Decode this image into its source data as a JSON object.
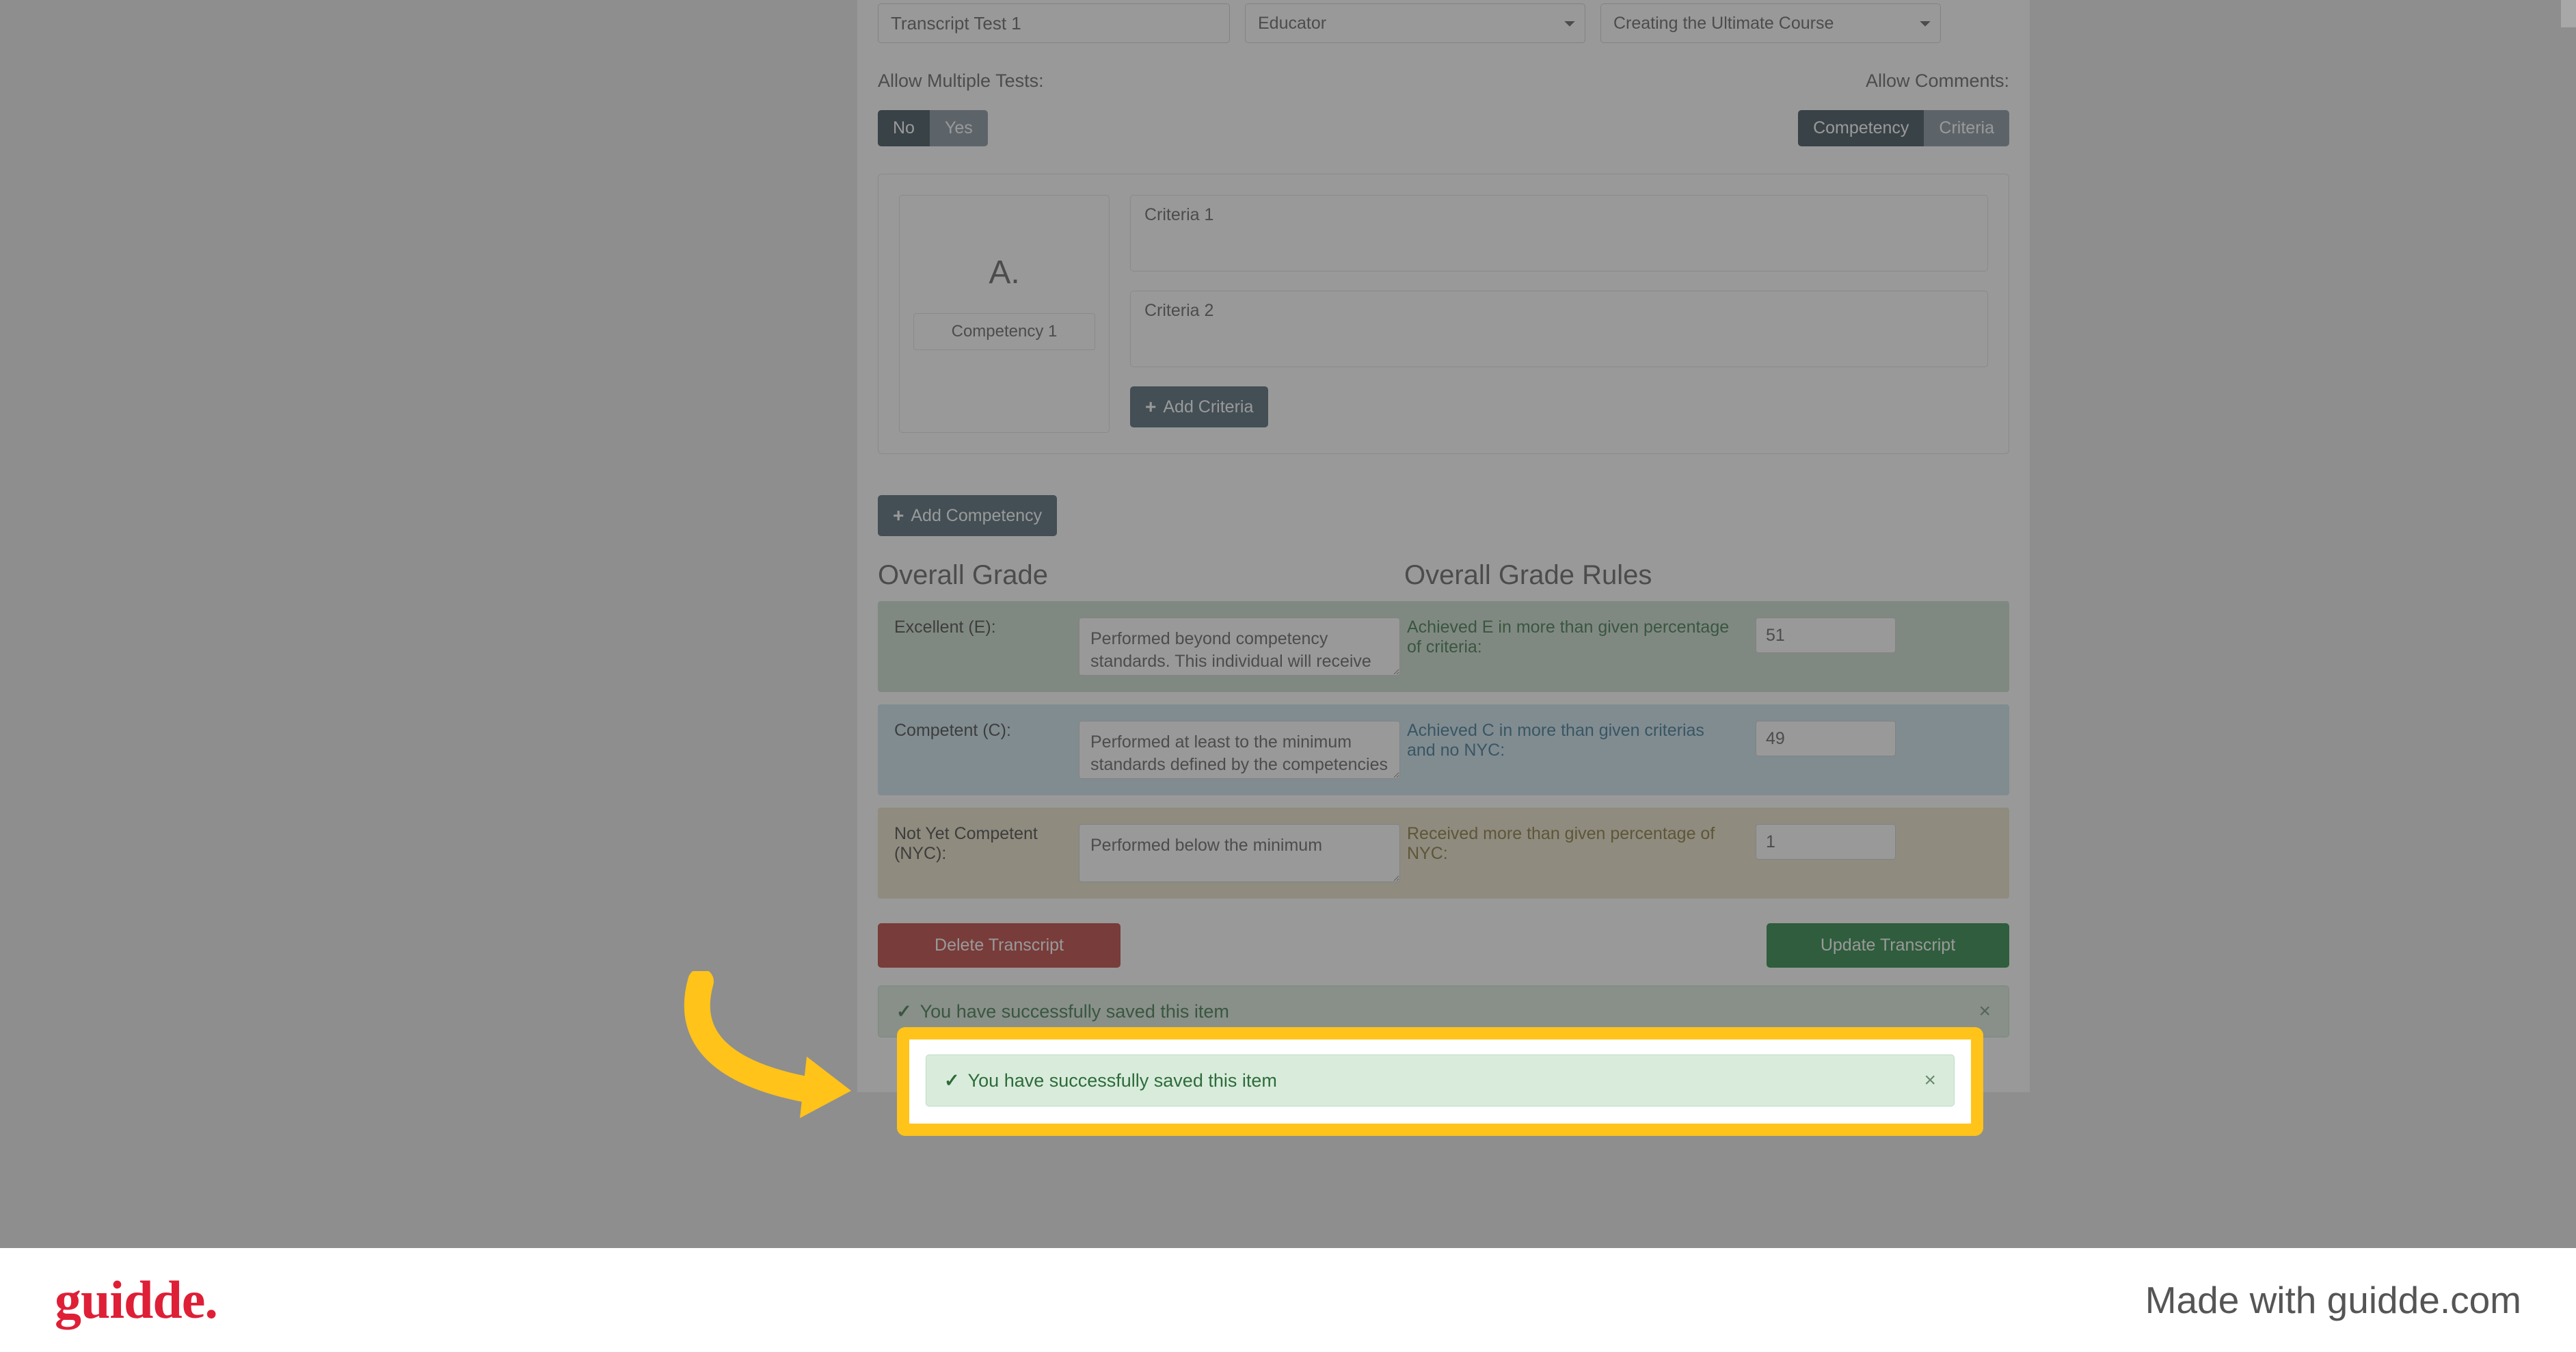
{
  "inputs": {
    "transcript_name": "Transcript Test 1",
    "role": "Educator",
    "course": "Creating the Ultimate Course"
  },
  "labels": {
    "allow_multiple": "Allow Multiple Tests:",
    "allow_comments": "Allow Comments:"
  },
  "multiple_toggle": {
    "no": "No",
    "yes": "Yes"
  },
  "comments_toggle": {
    "competency": "Competency",
    "criteria": "Criteria"
  },
  "competency": {
    "letter": "A.",
    "name": "Competency 1"
  },
  "criteria": [
    "Criteria 1",
    "Criteria 2"
  ],
  "buttons": {
    "add_criteria": "Add Criteria",
    "add_competency": "Add Competency",
    "delete": "Delete Transcript",
    "update": "Update Transcript"
  },
  "headings": {
    "overall_grade": "Overall Grade",
    "overall_rules": "Overall Grade Rules"
  },
  "grades": {
    "e": {
      "label": "Excellent (E):",
      "desc": "Performed beyond competency standards. This individual will receive",
      "rule": "Achieved E in more than given percentage of criteria:",
      "value": "51"
    },
    "c": {
      "label": "Competent (C):",
      "desc": "Performed at least to the minimum standards defined by the competencies",
      "rule": "Achieved C in more than given criterias and no NYC:",
      "value": "49"
    },
    "nyc": {
      "label": "Not Yet Competent (NYC):",
      "desc": "Performed below the minimum",
      "rule": "Received more than given percentage of NYC:",
      "value": "1"
    }
  },
  "alert": {
    "message": "You have successfully saved this item"
  },
  "footer": {
    "logo": "guidde.",
    "made_with": "Made with guidde.com"
  }
}
